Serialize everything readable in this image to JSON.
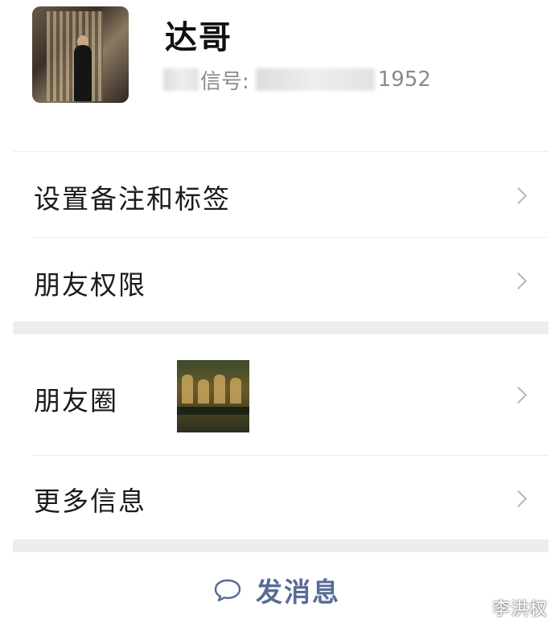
{
  "profile": {
    "name": "达哥",
    "wechat_id_label": "信号:",
    "wechat_id_suffix": "1952"
  },
  "menu_group_1": [
    {
      "label": "设置备注和标签"
    },
    {
      "label": "朋友权限"
    }
  ],
  "menu_group_2": [
    {
      "label": "朋友圈"
    },
    {
      "label": "更多信息"
    }
  ],
  "action": {
    "send_message_label": "发消息",
    "icon": "chat-bubble-icon"
  },
  "watermark": "李洪权",
  "colors": {
    "accent": "#576b95",
    "gap_background": "#ededed",
    "chevron": "#b5b5b5"
  }
}
